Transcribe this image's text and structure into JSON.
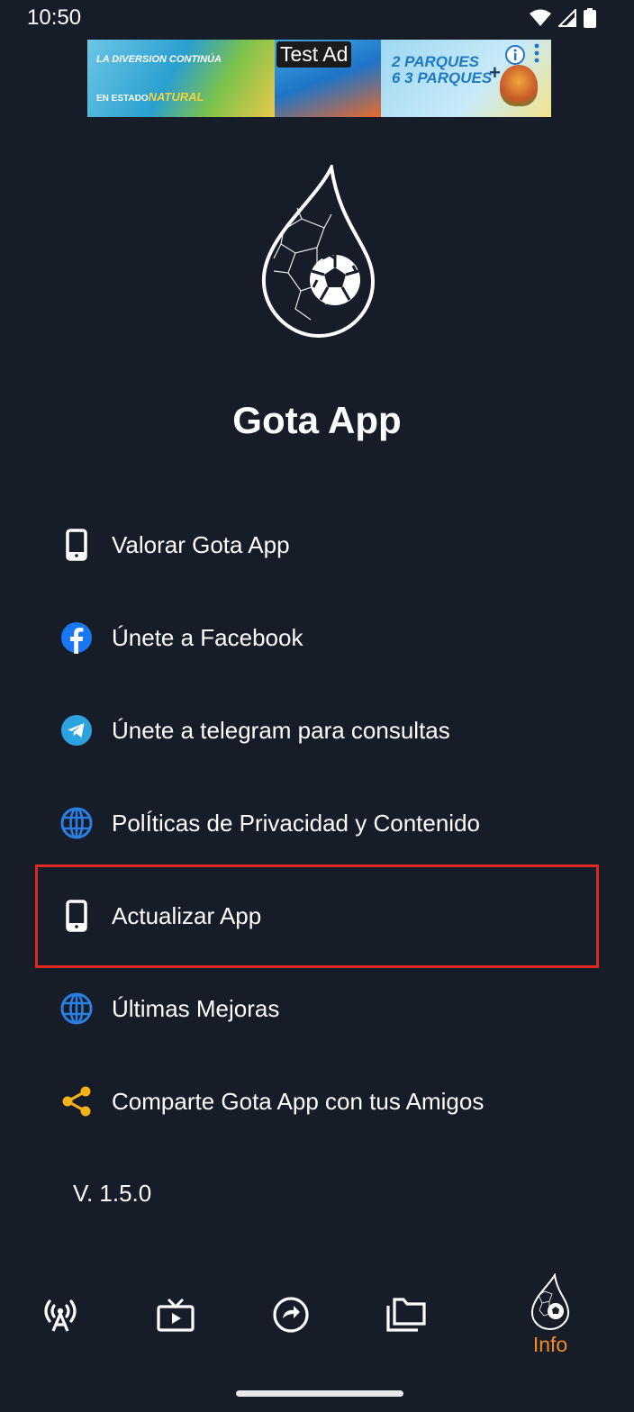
{
  "status_bar": {
    "time": "10:50"
  },
  "ad": {
    "label": "Test Ad",
    "tagline_1": "LA DIVERSION CONTINÚA",
    "tagline_2_prefix": "EN ESTADO",
    "tagline_2_highlight": "NATURAL",
    "promo": "2 PARQUES\n6 3 PARQUES",
    "plus": "+"
  },
  "app": {
    "title": "Gota App"
  },
  "menu": {
    "items": [
      {
        "label": "Valorar Gota App",
        "icon": "phone-icon"
      },
      {
        "label": "Únete a Facebook",
        "icon": "facebook-icon"
      },
      {
        "label": "Únete a telegram para consultas",
        "icon": "telegram-icon"
      },
      {
        "label": "PolÍticas de Privacidad y Contenido",
        "icon": "globe-icon"
      },
      {
        "label": "Actualizar App",
        "icon": "phone-icon"
      },
      {
        "label": "Últimas Mejoras",
        "icon": "globe-icon"
      },
      {
        "label": "Comparte Gota App con tus Amigos",
        "icon": "share-icon"
      }
    ]
  },
  "version": "V. 1.5.0",
  "bottom_nav": {
    "items": [
      {
        "icon": "broadcast-icon",
        "label": ""
      },
      {
        "icon": "tv-icon",
        "label": ""
      },
      {
        "icon": "replay-icon",
        "label": ""
      },
      {
        "icon": "folders-icon",
        "label": ""
      },
      {
        "icon": "gota-logo-icon",
        "label": "Info",
        "active": true
      }
    ]
  },
  "colors": {
    "background": "#161c28",
    "accent": "#f28c1f",
    "facebook": "#1877f2",
    "telegram": "#2aa3e0",
    "globe": "#2b7fe0",
    "share": "#f5b21a",
    "highlight": "#e0271f"
  }
}
